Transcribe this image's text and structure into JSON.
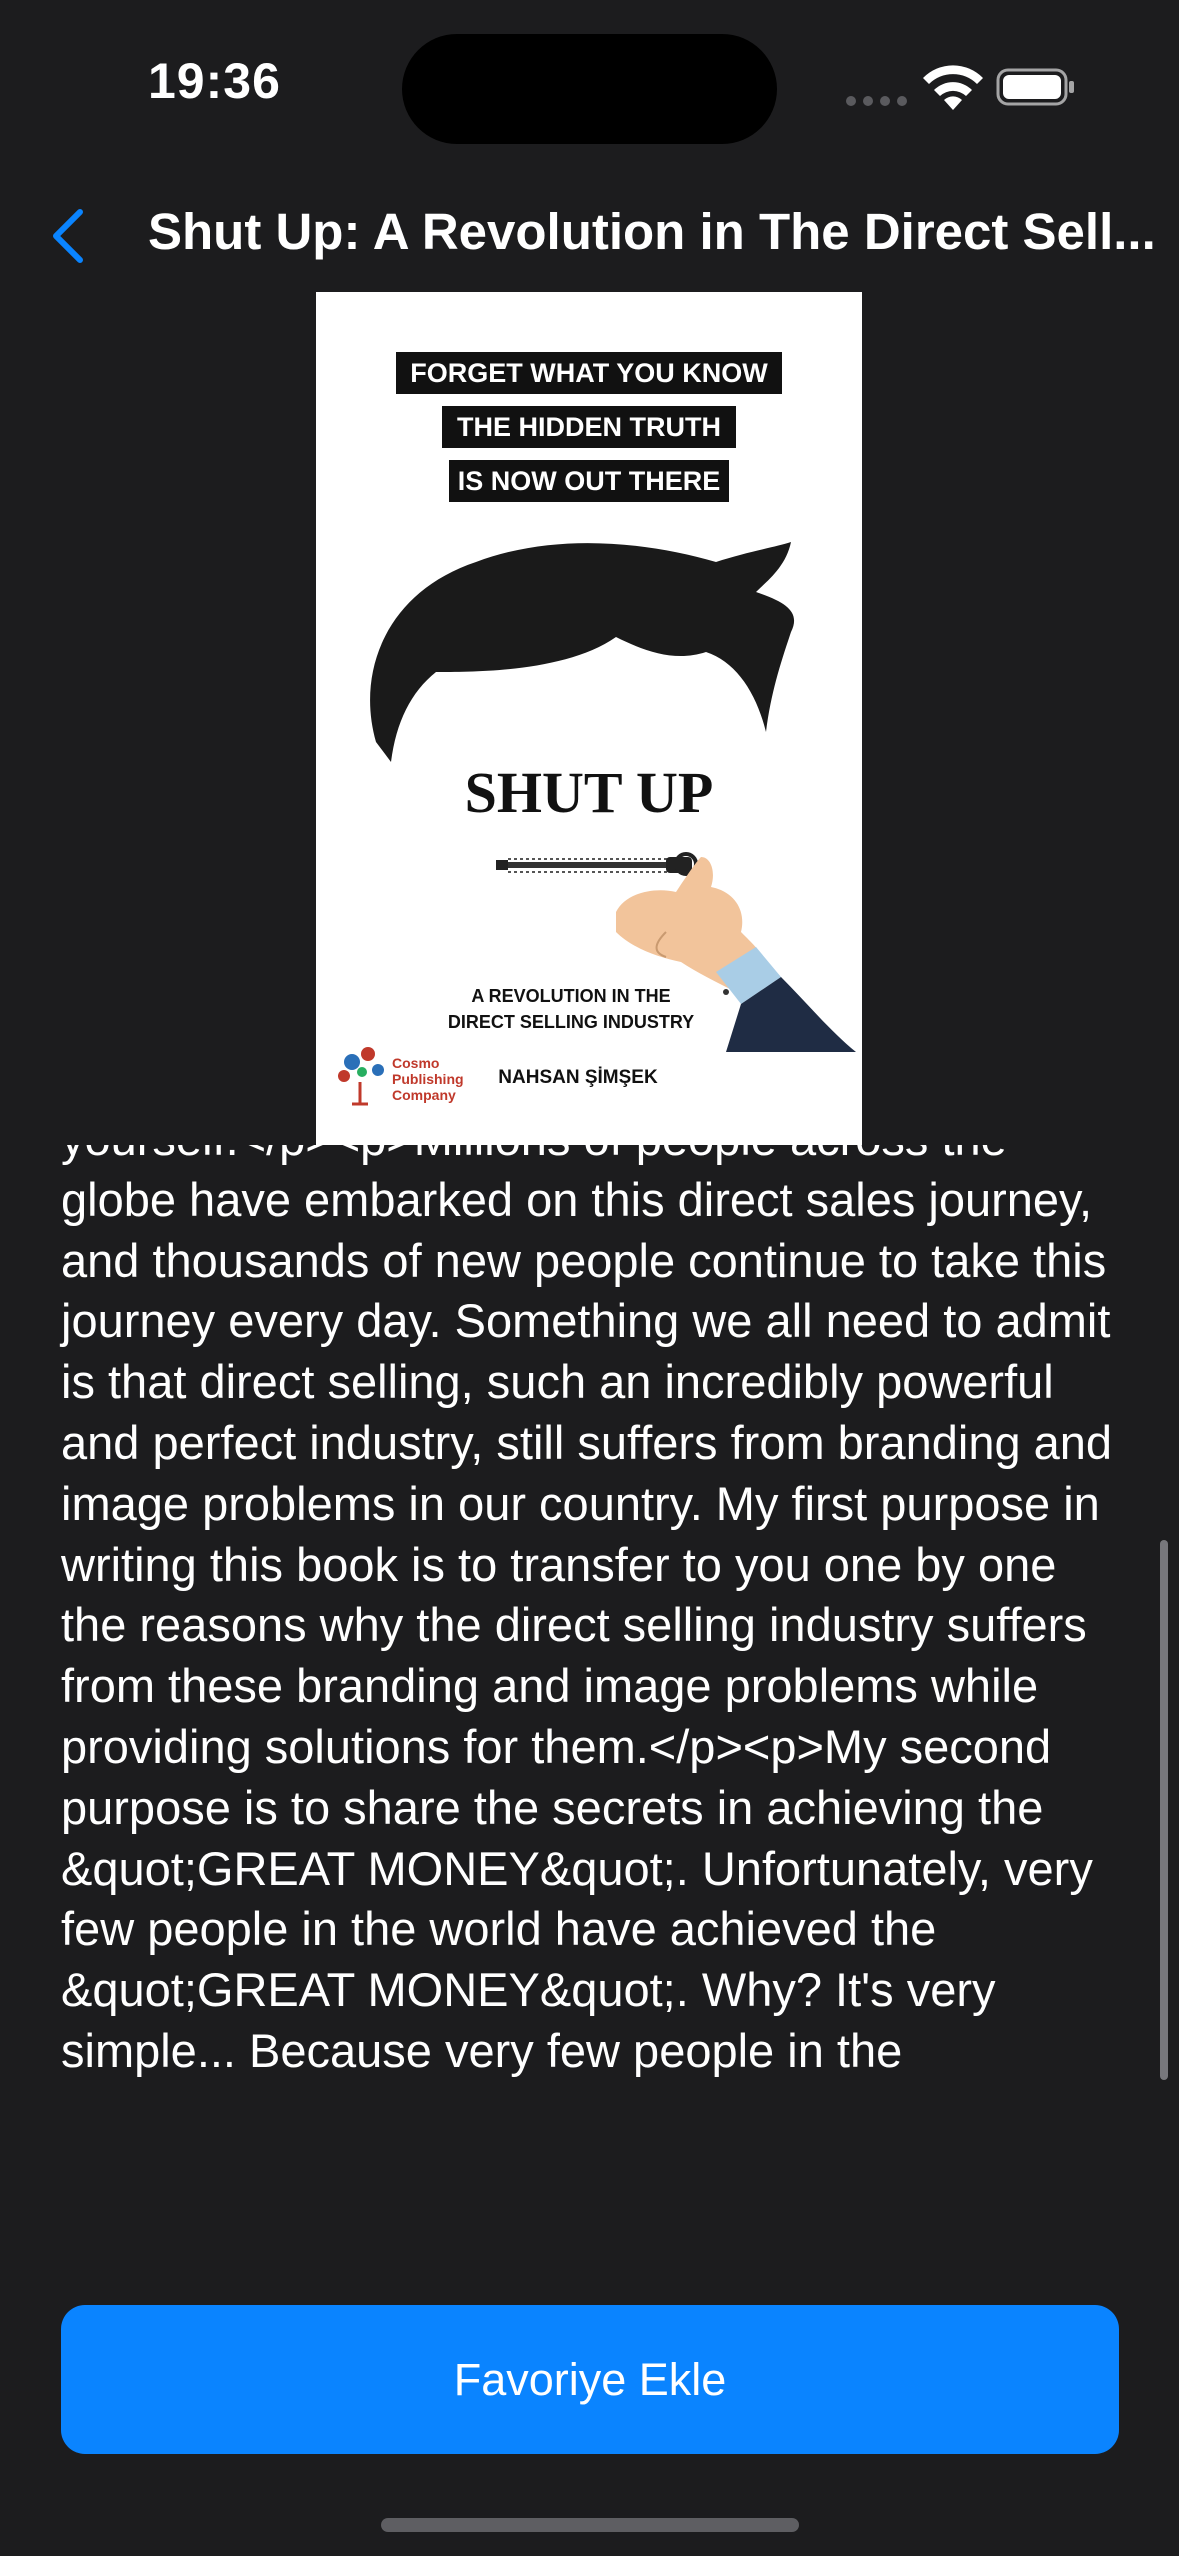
{
  "status_bar": {
    "time": "19:36"
  },
  "nav": {
    "title": "Shut Up: A Revolution in The Direct Sell..."
  },
  "cover": {
    "banner_lines": [
      "FORGET WHAT YOU KNOW",
      "THE HIDDEN TRUTH",
      "IS NOW OUT THERE"
    ],
    "title": "SHUT UP",
    "subtitle_lines": [
      "A REVOLUTION IN THE",
      "DIRECT SELLING INDUSTRY"
    ],
    "author": "NAHSAN ŞİMŞEK",
    "publisher_lines": [
      "Cosmo",
      "Publishing",
      "Company"
    ]
  },
  "description": {
    "text": "yourself.</p><p>Millions of people across the globe have embarked on this direct sales journey, and thousands of new people continue to take this journey every day. Something we all need to admit is that direct selling, such an incredibly powerful and perfect industry, still suffers from branding and image problems in our country. My first purpose in writing this book is to transfer to you one by one the reasons why the direct selling industry suffers from these branding and image problems while providing solutions for them.</p><p>My second purpose is to share the secrets in achieving the &quot;GREAT MONEY&quot;. Unfortunately, very few people in the world have achieved the &quot;GREAT MONEY&quot;. Why? It's very simple... Because very few people in the"
  },
  "actions": {
    "favorite_label": "Favoriye Ekle"
  },
  "colors": {
    "background": "#1c1c1e",
    "accent": "#0a84ff",
    "text": "#ffffff"
  }
}
